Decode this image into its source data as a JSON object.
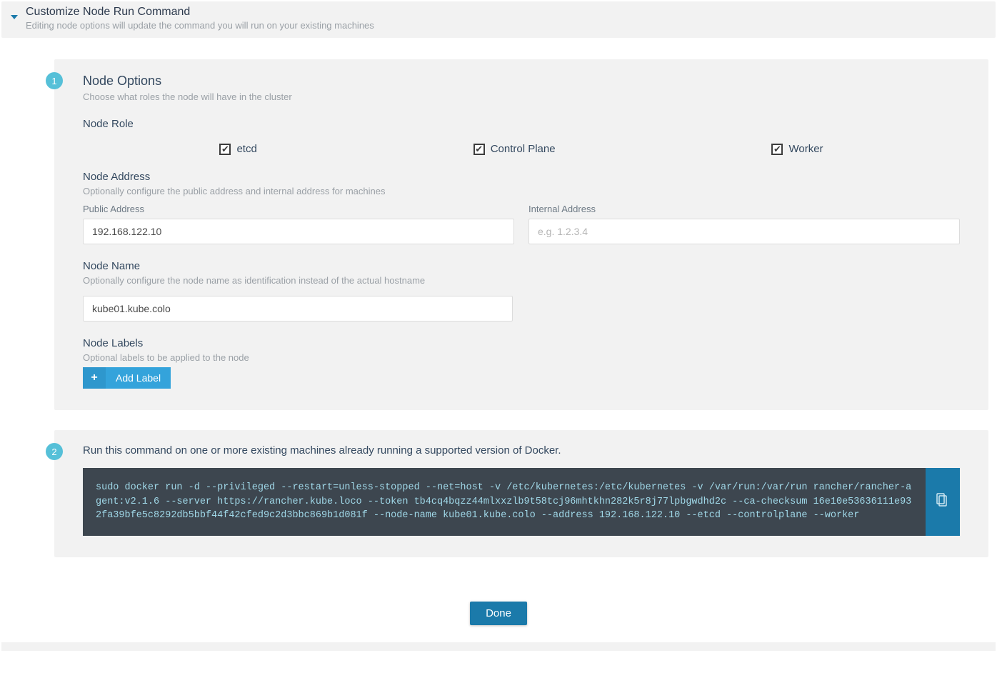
{
  "accordion": {
    "title": "Customize Node Run Command",
    "subtitle": "Editing node options will update the command you will run on your existing machines"
  },
  "step1_badge": "1",
  "step2_badge": "2",
  "node_options": {
    "title": "Node Options",
    "subtitle": "Choose what roles the node will have in the cluster"
  },
  "node_role": {
    "label": "Node Role",
    "roles": {
      "etcd": "etcd",
      "control_plane": "Control Plane",
      "worker": "Worker"
    }
  },
  "node_address": {
    "label": "Node Address",
    "subtitle": "Optionally configure the public address and internal address for machines",
    "public_label": "Public Address",
    "public_value": "192.168.122.10",
    "internal_label": "Internal Address",
    "internal_placeholder": "e.g. 1.2.3.4",
    "internal_value": ""
  },
  "node_name": {
    "label": "Node Name",
    "subtitle": "Optionally configure the node name as identification instead of the actual hostname",
    "value": "kube01.kube.colo"
  },
  "node_labels": {
    "label": "Node Labels",
    "subtitle": "Optional labels to be applied to the node",
    "add_button": "Add Label"
  },
  "run_command": {
    "instruction": "Run this command on one or more existing machines already running a supported version of Docker.",
    "command": "sudo docker run -d --privileged --restart=unless-stopped --net=host -v /etc/kubernetes:/etc/kubernetes -v /var/run:/var/run rancher/rancher-agent:v2.1.6 --server https://rancher.kube.loco --token tb4cq4bqzz44mlxxzlb9t58tcj96mhtkhn282k5r8j77lpbgwdhd2c --ca-checksum 16e10e53636111e932fa39bfe5c8292db5bbf44f42cfed9c2d3bbc869b1d081f --node-name kube01.kube.colo --address 192.168.122.10 --etcd --controlplane --worker"
  },
  "done_button": "Done",
  "icons": {
    "caret": "chevron-down-icon",
    "plus": "plus-icon",
    "clipboard": "clipboard-icon"
  }
}
